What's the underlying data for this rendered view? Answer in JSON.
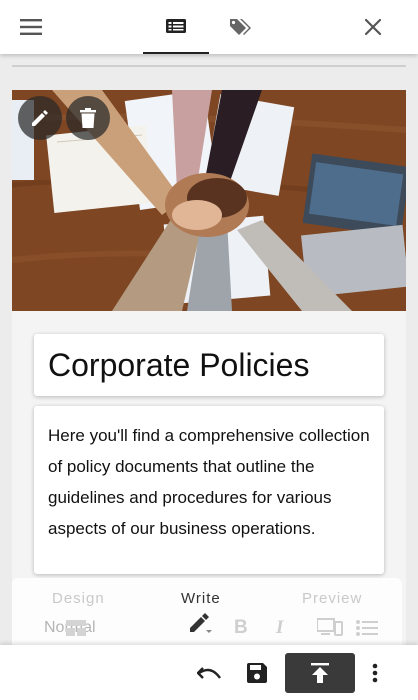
{
  "topbar": {
    "icons": [
      "menu-icon",
      "article-icon",
      "tags-icon",
      "close-icon"
    ],
    "active_tab": "article"
  },
  "page": {
    "title": "Corporate Policies",
    "description": "Here you'll find a comprehensive collection of policy documents that outline the guidelines and procedures for various aspects of our business operations."
  },
  "hero": {
    "actions": [
      "edit-icon",
      "delete-icon"
    ]
  },
  "editor": {
    "modes": {
      "design": "Design",
      "write": "Write",
      "preview": "Preview"
    },
    "active_mode": "Write",
    "block_style": "Normal",
    "format": {
      "bold": "B",
      "italic": "I"
    }
  },
  "bottombar": {
    "actions": [
      "undo-icon",
      "save-icon",
      "publish-icon",
      "more-icon"
    ]
  },
  "colors": {
    "accent": "#222222",
    "publish_bg": "#3a3a3a",
    "wood": "#7a4420"
  }
}
